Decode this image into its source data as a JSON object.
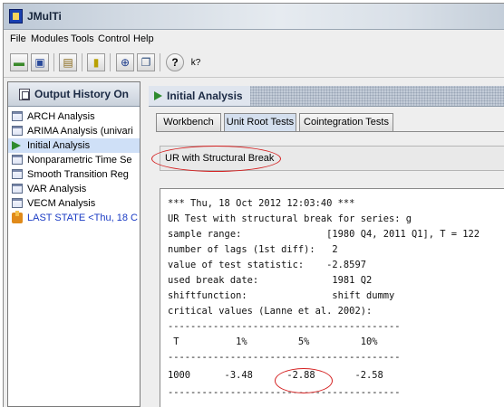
{
  "window": {
    "title": "JMulTi"
  },
  "menu": [
    "File",
    "Modules",
    "Tools",
    "Control",
    "Help"
  ],
  "toolbar": {
    "buttons": [
      {
        "name": "open-icon",
        "glyph": "▬"
      },
      {
        "name": "save-icon",
        "glyph": "▣"
      },
      {
        "name": "folder-icon",
        "glyph": "▤"
      },
      {
        "name": "calculator-icon",
        "glyph": "▮"
      },
      {
        "name": "navigate-icon",
        "glyph": "⊕"
      },
      {
        "name": "copy-icon",
        "glyph": "❐"
      },
      {
        "name": "help-icon",
        "glyph": "?"
      },
      {
        "name": "context-help-icon",
        "glyph": "k?"
      }
    ]
  },
  "history": {
    "header": "Output History On",
    "items": [
      {
        "label": "ARCH Analysis",
        "icon": "document-icon"
      },
      {
        "label": "ARIMA Analysis (univari",
        "icon": "document-icon"
      },
      {
        "label": "Initial Analysis",
        "icon": "play-icon",
        "selected": true
      },
      {
        "label": "Nonparametric Time Se",
        "icon": "document-icon"
      },
      {
        "label": "Smooth Transition Reg",
        "icon": "document-icon"
      },
      {
        "label": "VAR Analysis",
        "icon": "document-icon"
      },
      {
        "label": "VECM Analysis",
        "icon": "document-icon"
      },
      {
        "label": "LAST STATE <Thu, 18 C",
        "icon": "state-icon"
      }
    ]
  },
  "analysis": {
    "header": "Initial Analysis",
    "tabs": [
      "Workbench",
      "Unit Root Tests",
      "Cointegration Tests"
    ],
    "active_tab": "Unit Root Tests",
    "selector": "UR with Structural Break"
  },
  "output": {
    "lines": [
      "*** Thu, 18 Oct 2012 12:03:40 ***",
      "UR Test with structural break for series: g",
      "sample range:               [1980 Q4, 2011 Q1], T = 122",
      "number of lags (1st diff):   2",
      "value of test statistic:    -2.8597",
      "used break date:             1981 Q2",
      "shiftfunction:               shift dummy",
      "critical values (Lanne et al. 2002):",
      "-----------------------------------------",
      " T          1%         5%         10%",
      "-----------------------------------------",
      "1000      -3.48      -2.88       -2.58",
      "-----------------------------------------"
    ]
  },
  "colors": {
    "highlight_ellipse": "#d42020",
    "selection": "#cfe0f7",
    "last_state": "#1a3bc4"
  }
}
